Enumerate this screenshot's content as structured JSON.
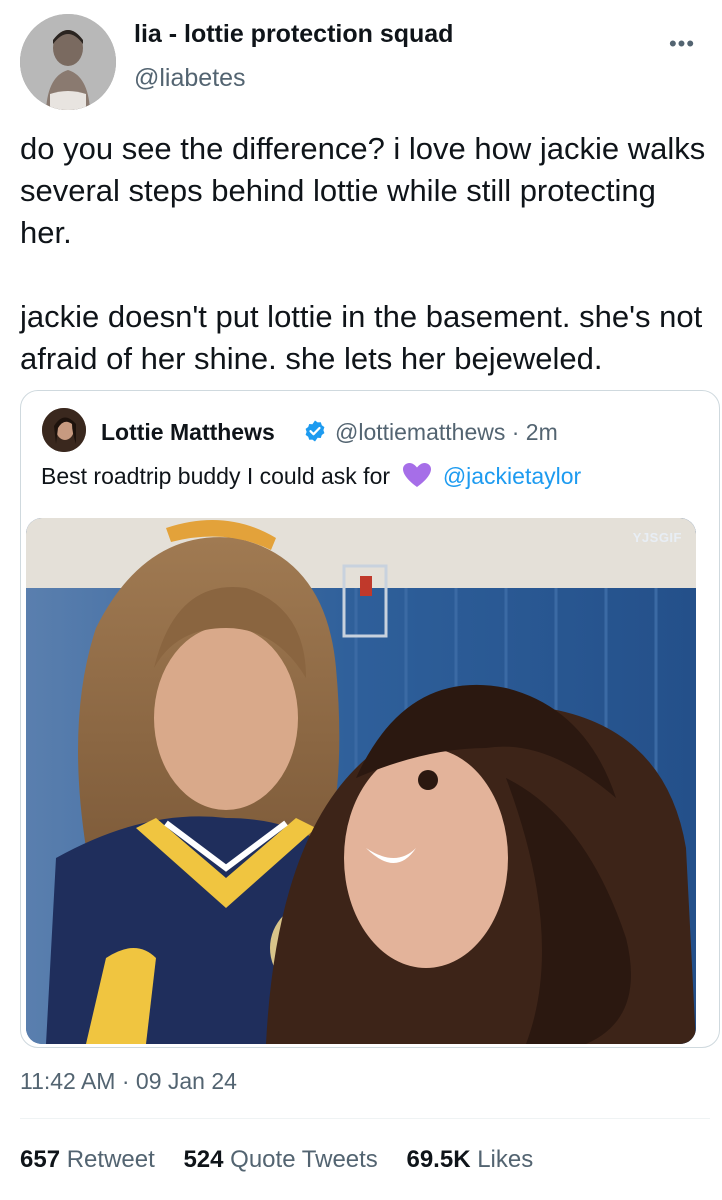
{
  "author": {
    "display_name": "lia - lottie protection squad",
    "handle": "@liabetes",
    "avatar_icon": "profile-photo"
  },
  "more_icon": "ellipsis-icon",
  "more_label": "•••",
  "tweet": {
    "text": "do you see the difference? i love how jackie walks several steps behind  lottie while still protecting her.\n\njackie doesn't put lottie in the basement. she's not afraid of her shine. she lets her bejeweled."
  },
  "quote": {
    "display_name": "Lottie Matthews",
    "handle_time": "@lottiematthews · 2m",
    "text": "Best roadtrip buddy I could ask for",
    "emoji": "purple-heart",
    "mention": "@jackietaylor",
    "watermark": "YJSGIF",
    "verified_color": "#1d9bf0",
    "heart_color": "#a66ee8"
  },
  "timestamp": "11:42 AM · 09 Jan 24",
  "stats": {
    "retweets": {
      "count": "657",
      "label": "Retweet"
    },
    "quotes": {
      "count": "524",
      "label": "Quote Tweets"
    },
    "likes": {
      "count": "69.5K",
      "label": "Likes"
    }
  }
}
